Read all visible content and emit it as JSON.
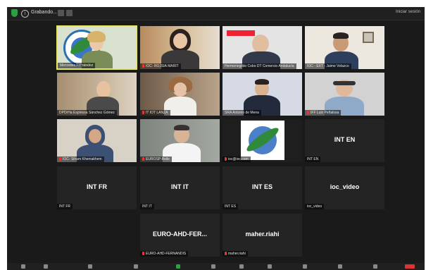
{
  "window": {
    "title": "Grabando...",
    "record_label": "Iniciar sesión"
  },
  "tiles": [
    {
      "id": "t1",
      "name": "Mercedes Fernández",
      "muted": false,
      "active": true,
      "type": "video",
      "bg": "#cfd9c8"
    },
    {
      "id": "t2",
      "name": "IOC- ROJSIA MARIT",
      "muted": true,
      "type": "video",
      "bg": "#c9a57d"
    },
    {
      "id": "t3",
      "name": "Hermenegildo Cobo DT Comercio Andalucía",
      "muted": false,
      "type": "video",
      "bg": "#d8d8d8"
    },
    {
      "id": "t4",
      "name": "IOC - EXT - Jaime Velazco",
      "muted": false,
      "type": "video",
      "bg": "#eae6de"
    },
    {
      "id": "t5",
      "name": "DPDrHa Espinosa Sánchez Gómez",
      "muted": false,
      "type": "video",
      "bg": "#bfae96"
    },
    {
      "id": "t6",
      "name": "IT IOT LANZA",
      "muted": true,
      "type": "video",
      "bg": "#8e7a66"
    },
    {
      "id": "t7",
      "name": "SRA Antonio de Mena",
      "muted": false,
      "type": "video",
      "bg": "#cdd3de"
    },
    {
      "id": "t8",
      "name": "IFF Luis Peñalosa",
      "muted": true,
      "type": "video",
      "bg": "#cfcfcf"
    },
    {
      "id": "t9",
      "name": "IOC- Siham Khemakhem",
      "muted": true,
      "type": "video",
      "bg": "#d6d0c4"
    },
    {
      "id": "t10",
      "name": "EUROSP-Belle",
      "muted": true,
      "type": "video",
      "bg": "#8a8f8a"
    },
    {
      "id": "t11",
      "name": "ioc@ioc.com",
      "muted": true,
      "type": "logo",
      "bg": "#1e1e1e"
    },
    {
      "id": "t12",
      "name": "INT EN",
      "big": "INT EN",
      "type": "text"
    },
    {
      "id": "t13",
      "name": "INT FR",
      "big": "INT FR",
      "type": "text"
    },
    {
      "id": "t14",
      "name": "INT IT",
      "big": "INT IT",
      "type": "text"
    },
    {
      "id": "t15",
      "name": "INT ES",
      "big": "INT ES",
      "type": "text"
    },
    {
      "id": "t16",
      "name": "ioc_video",
      "big": "ioc_video",
      "type": "text"
    },
    {
      "id": "t17",
      "name": "EURO-AHD-FERNANDIS",
      "big": "EURO-AHD-FER...",
      "muted": true,
      "type": "text"
    },
    {
      "id": "t18",
      "name": "maher.riahi",
      "big": "maher.riahi",
      "muted": true,
      "type": "text"
    }
  ]
}
